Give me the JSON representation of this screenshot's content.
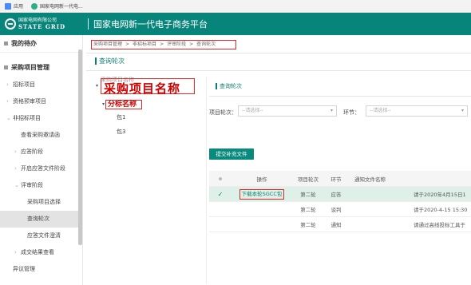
{
  "bookmarks": {
    "apps": "应用",
    "site": "国家电网新一代电..."
  },
  "header": {
    "company_cn": "国家电网有限公司",
    "company_en": "STATE GRID",
    "platform_title": "国家电网新一代电子商务平台"
  },
  "sidebar": {
    "todo": "我的待办",
    "project_mgmt": "采购项目管理",
    "items": {
      "bidding": "招标项目",
      "prequal": "资格预审项目",
      "nonbid": "非招标项目",
      "view_invite": "查看采购邀请函",
      "response": "应答阶段",
      "open_doc": "开启应答文件阶段",
      "review": "评审阶段",
      "proc_select": "采购项目选择",
      "query_round": "查询轮次",
      "clarify": "应答文件澄清",
      "result": "成交结果查看",
      "dispute": "异议管理"
    }
  },
  "breadcrumb": {
    "p1": "采购项目管理",
    "sep": ">",
    "p2": "非招标项目",
    "p3": "评审阶段",
    "p4": "查询轮次"
  },
  "page_title": "查询轮次",
  "tree": {
    "root_label": "采购项目名称",
    "faint_text": "采购项目名称",
    "package_label": "分标名称",
    "leaf1": "包1",
    "leaf3": "包3"
  },
  "right": {
    "title": "查询轮次",
    "round_label": "项目轮次：",
    "round_placeholder": "--请选择--",
    "step_label": "环节：",
    "step_placeholder": "--请选择--",
    "submit_button": "提交补充文件"
  },
  "table": {
    "headers": {
      "op": "操作",
      "round": "项目轮次",
      "step": "环节",
      "notice": "通知文件名称"
    },
    "rows": [
      {
        "op": "下载本轮SGCC包",
        "round": "第二轮",
        "step": "应答",
        "notice": "",
        "desc": "请于2020年4月15日1"
      },
      {
        "op": "",
        "round": "第二轮",
        "step": "谈判",
        "notice": "",
        "desc": "请于2020-4-15 15:30"
      },
      {
        "op": "",
        "round": "第二轮",
        "step": "通知",
        "notice": "",
        "desc": "请通过高线投标工具于"
      }
    ]
  },
  "colors": {
    "header_bg": "#08857a",
    "accent": "#0a7f74",
    "annotation_red": "#d00000"
  }
}
